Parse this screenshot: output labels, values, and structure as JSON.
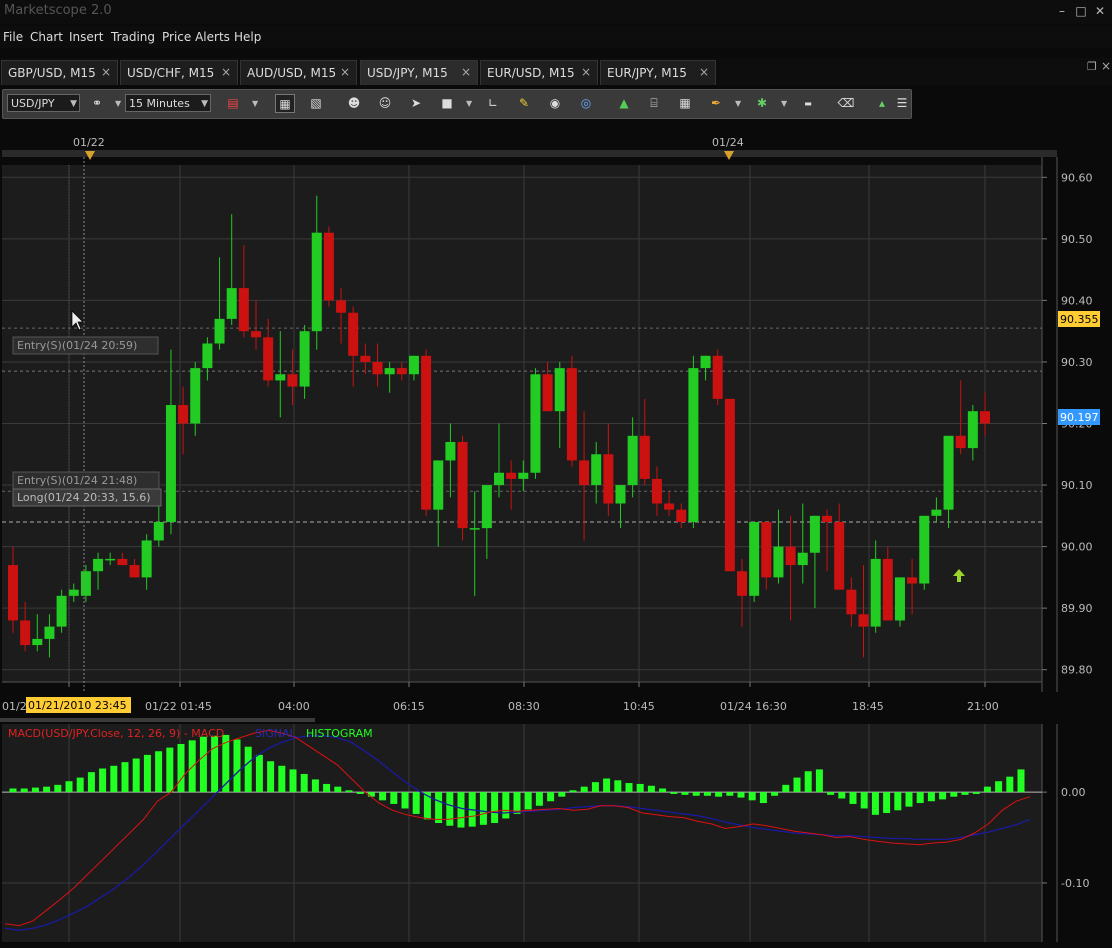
{
  "window": {
    "title": "Marketscope 2.0",
    "controls": {
      "minimize": "–",
      "maximize": "□",
      "close": "✕"
    }
  },
  "menu": [
    "File",
    "Chart",
    "Insert",
    "Trading",
    "Price Alerts",
    "Help"
  ],
  "tabs": [
    {
      "label": "GBP/USD, M15",
      "active": false
    },
    {
      "label": "USD/CHF, M15",
      "active": false
    },
    {
      "label": "AUD/USD, M15",
      "active": false
    },
    {
      "label": "USD/JPY, M15",
      "active": true
    },
    {
      "label": "EUR/USD, M15",
      "active": false
    },
    {
      "label": "EUR/JPY, M15",
      "active": false
    }
  ],
  "tab_close": "×",
  "toolbar": {
    "symbol": "USD/JPY",
    "timeframe": "15 Minutes",
    "icons": [
      "link-icon",
      "bar-style-icon",
      "candle-view-icon",
      "list-view-icon",
      "trader-icon",
      "trader-down-icon",
      "pointer-icon",
      "stop-icon",
      "cursor-icon",
      "note-icon",
      "eye-icon",
      "globe-icon",
      "chart-icon",
      "text-icon",
      "grid-icon",
      "pencil-icon",
      "signal-icon",
      "label-icon",
      "eraser-icon",
      "tree-icon",
      "menu-icon"
    ]
  },
  "colors": {
    "bull": "#22cc22",
    "bear": "#cc1111",
    "grid": "#3a3a3a",
    "axis_text": "#bbbbbb",
    "price_marker_orange": "#ffcc33",
    "price_marker_blue": "#3399ff",
    "macd_line": "#dd1111",
    "signal_line": "#1a1aa0",
    "histogram": "#22ff22"
  },
  "chart_data": [
    {
      "type": "candlestick",
      "symbol": "USD/JPY",
      "timeframe": "M15",
      "top_markers": [
        "01/22",
        "01/24"
      ],
      "x_tick_labels": [
        "01/2",
        "01/22 01:45",
        "04:00",
        "06:15",
        "08:30",
        "10:45",
        "01/24 16:30",
        "18:45",
        "21:00"
      ],
      "crosshair_time": "01/21/2010 23:45",
      "y_ticks": [
        "90.60",
        "90.50",
        "90.40",
        "90.30",
        "90.20",
        "90.10",
        "90.00",
        "89.90",
        "89.80"
      ],
      "ylim": [
        89.78,
        90.62
      ],
      "price_markers": [
        {
          "label": "90.355",
          "value": 90.355,
          "color": "orange"
        },
        {
          "label": "90.197",
          "value": 90.197,
          "color": "blue"
        }
      ],
      "order_labels": [
        {
          "text": "Entry(S)(01/24 20:59)",
          "price": 90.285
        },
        {
          "text": "Entry(S)(01/24 21:48)",
          "price": 90.09
        },
        {
          "text": "Long(01/24 20:33, 15.6)",
          "price": 90.065
        }
      ],
      "stop_level": 90.04,
      "candles": [
        [
          89.97,
          90.0,
          89.86,
          89.88
        ],
        [
          89.88,
          89.91,
          89.83,
          89.84
        ],
        [
          89.84,
          89.89,
          89.83,
          89.85
        ],
        [
          89.85,
          89.89,
          89.82,
          89.87
        ],
        [
          89.87,
          89.93,
          89.86,
          89.92
        ],
        [
          89.92,
          89.94,
          89.91,
          89.93
        ],
        [
          89.92,
          89.97,
          89.91,
          89.96
        ],
        [
          89.96,
          89.99,
          89.93,
          89.98
        ],
        [
          89.98,
          89.99,
          89.97,
          89.98
        ],
        [
          89.98,
          89.99,
          89.97,
          89.97
        ],
        [
          89.97,
          89.98,
          89.95,
          89.95
        ],
        [
          89.95,
          90.02,
          89.93,
          90.01
        ],
        [
          90.01,
          90.1,
          90.0,
          90.04
        ],
        [
          90.04,
          90.32,
          90.02,
          90.23
        ],
        [
          90.23,
          90.26,
          90.15,
          90.2
        ],
        [
          90.2,
          90.3,
          90.18,
          90.29
        ],
        [
          90.29,
          90.34,
          90.27,
          90.33
        ],
        [
          90.33,
          90.47,
          90.32,
          90.37
        ],
        [
          90.37,
          90.54,
          90.36,
          90.42
        ],
        [
          90.42,
          90.49,
          90.34,
          90.35
        ],
        [
          90.35,
          90.4,
          90.32,
          90.34
        ],
        [
          90.34,
          90.37,
          90.26,
          90.27
        ],
        [
          90.27,
          90.35,
          90.21,
          90.28
        ],
        [
          90.28,
          90.32,
          90.23,
          90.26
        ],
        [
          90.26,
          90.36,
          90.24,
          90.35
        ],
        [
          90.35,
          90.57,
          90.32,
          90.51
        ],
        [
          90.51,
          90.52,
          90.39,
          90.4
        ],
        [
          90.4,
          90.42,
          90.33,
          90.38
        ],
        [
          90.38,
          90.39,
          90.26,
          90.31
        ],
        [
          90.31,
          90.33,
          90.28,
          90.3
        ],
        [
          90.3,
          90.33,
          90.26,
          90.28
        ],
        [
          90.28,
          90.3,
          90.25,
          90.29
        ],
        [
          90.29,
          90.3,
          90.27,
          90.28
        ],
        [
          90.28,
          90.31,
          90.27,
          90.31
        ],
        [
          90.31,
          90.32,
          90.05,
          90.06
        ],
        [
          90.06,
          90.14,
          90.0,
          90.14
        ],
        [
          90.14,
          90.2,
          90.08,
          90.17
        ],
        [
          90.17,
          90.18,
          90.01,
          90.03
        ],
        [
          90.03,
          90.09,
          89.92,
          90.03
        ],
        [
          90.03,
          90.07,
          89.98,
          90.1
        ],
        [
          90.1,
          90.2,
          90.08,
          90.12
        ],
        [
          90.12,
          90.14,
          90.06,
          90.11
        ],
        [
          90.11,
          90.14,
          90.09,
          90.12
        ],
        [
          90.12,
          90.29,
          90.11,
          90.28
        ],
        [
          90.28,
          90.3,
          90.22,
          90.22
        ],
        [
          90.22,
          90.3,
          90.16,
          90.29
        ],
        [
          90.29,
          90.31,
          90.13,
          90.14
        ],
        [
          90.14,
          90.22,
          90.01,
          90.1
        ],
        [
          90.1,
          90.17,
          90.07,
          90.15
        ],
        [
          90.15,
          90.2,
          90.05,
          90.07
        ],
        [
          90.07,
          90.09,
          90.03,
          90.1
        ],
        [
          90.1,
          90.21,
          90.08,
          90.18
        ],
        [
          90.18,
          90.24,
          90.1,
          90.11
        ],
        [
          90.11,
          90.13,
          90.05,
          90.07
        ],
        [
          90.07,
          90.09,
          90.05,
          90.06
        ],
        [
          90.06,
          90.07,
          90.03,
          90.04
        ],
        [
          90.04,
          90.31,
          90.03,
          90.29
        ],
        [
          90.29,
          90.31,
          90.27,
          90.31
        ],
        [
          90.31,
          90.32,
          90.23,
          90.24
        ],
        [
          90.24,
          90.24,
          89.96,
          89.96
        ],
        [
          89.96,
          89.98,
          89.87,
          89.92
        ],
        [
          89.92,
          90.04,
          89.91,
          90.04
        ],
        [
          90.04,
          90.04,
          89.93,
          89.95
        ],
        [
          89.95,
          90.06,
          89.94,
          90.0
        ],
        [
          90.0,
          90.05,
          89.88,
          89.97
        ],
        [
          89.97,
          90.07,
          89.94,
          89.99
        ],
        [
          89.99,
          90.05,
          89.9,
          90.05
        ],
        [
          90.05,
          90.06,
          89.96,
          90.04
        ],
        [
          90.04,
          90.07,
          89.94,
          89.93
        ],
        [
          89.93,
          89.95,
          89.87,
          89.89
        ],
        [
          89.89,
          89.97,
          89.82,
          89.87
        ],
        [
          89.87,
          90.01,
          89.86,
          89.98
        ],
        [
          89.98,
          90.0,
          89.88,
          89.88
        ],
        [
          89.88,
          89.95,
          89.87,
          89.95
        ],
        [
          89.95,
          89.98,
          89.89,
          89.94
        ],
        [
          89.94,
          90.05,
          89.93,
          90.05
        ],
        [
          90.05,
          90.08,
          90.04,
          90.06
        ],
        [
          90.06,
          90.18,
          90.03,
          90.18
        ],
        [
          90.18,
          90.27,
          90.15,
          90.16
        ],
        [
          90.16,
          90.23,
          90.14,
          90.22
        ],
        [
          90.22,
          90.25,
          90.18,
          90.2
        ]
      ]
    },
    {
      "type": "bar-line",
      "title": "MACD(USD/JPY.Close, 12, 26, 9) - MACD",
      "legend": [
        "SIGNAL",
        "HISTOGRAM"
      ],
      "y_ticks": [
        "0.00",
        "-0.10"
      ],
      "ylim": [
        -0.165,
        0.075
      ],
      "macd": [
        -0.145,
        -0.147,
        -0.142,
        -0.13,
        -0.118,
        -0.105,
        -0.09,
        -0.075,
        -0.06,
        -0.045,
        -0.03,
        -0.01,
        0.0,
        0.02,
        0.035,
        0.048,
        0.055,
        0.06,
        0.065,
        0.068,
        0.065,
        0.06,
        0.05,
        0.04,
        0.03,
        0.015,
        0.0,
        -0.012,
        -0.02,
        -0.025,
        -0.028,
        -0.03,
        -0.03,
        -0.028,
        -0.026,
        -0.022,
        -0.02,
        -0.021,
        -0.02,
        -0.019,
        -0.018,
        -0.02,
        -0.019,
        -0.015,
        -0.015,
        -0.017,
        -0.023,
        -0.025,
        -0.027,
        -0.028,
        -0.032,
        -0.035,
        -0.04,
        -0.038,
        -0.035,
        -0.037,
        -0.04,
        -0.043,
        -0.045,
        -0.047,
        -0.05,
        -0.049,
        -0.052,
        -0.054,
        -0.056,
        -0.057,
        -0.058,
        -0.056,
        -0.055,
        -0.052,
        -0.045,
        -0.035,
        -0.02,
        -0.01,
        -0.005
      ],
      "signal": [
        -0.15,
        -0.152,
        -0.15,
        -0.146,
        -0.14,
        -0.133,
        -0.125,
        -0.115,
        -0.105,
        -0.093,
        -0.08,
        -0.065,
        -0.05,
        -0.035,
        -0.02,
        -0.005,
        0.01,
        0.025,
        0.038,
        0.048,
        0.055,
        0.06,
        0.062,
        0.062,
        0.06,
        0.055,
        0.045,
        0.034,
        0.022,
        0.01,
        0.0,
        -0.008,
        -0.014,
        -0.018,
        -0.02,
        -0.022,
        -0.023,
        -0.022,
        -0.021,
        -0.02,
        -0.019,
        -0.017,
        -0.016,
        -0.015,
        -0.015,
        -0.016,
        -0.018,
        -0.02,
        -0.022,
        -0.024,
        -0.026,
        -0.029,
        -0.033,
        -0.036,
        -0.039,
        -0.041,
        -0.043,
        -0.045,
        -0.046,
        -0.047,
        -0.048,
        -0.048,
        -0.049,
        -0.05,
        -0.051,
        -0.051,
        -0.052,
        -0.052,
        -0.052,
        -0.05,
        -0.047,
        -0.044,
        -0.04,
        -0.036,
        -0.03
      ],
      "histogram": [
        0.004,
        0.004,
        0.005,
        0.006,
        0.008,
        0.012,
        0.016,
        0.022,
        0.026,
        0.029,
        0.033,
        0.037,
        0.041,
        0.045,
        0.049,
        0.053,
        0.057,
        0.061,
        0.062,
        0.063,
        0.058,
        0.05,
        0.041,
        0.034,
        0.029,
        0.025,
        0.02,
        0.014,
        0.009,
        0.006,
        0.002,
        -0.002,
        -0.005,
        -0.009,
        -0.013,
        -0.018,
        -0.024,
        -0.03,
        -0.034,
        -0.037,
        -0.039,
        -0.038,
        -0.036,
        -0.034,
        -0.029,
        -0.024,
        -0.019,
        -0.015,
        -0.01,
        -0.005,
        0.002,
        0.006,
        0.011,
        0.015,
        0.013,
        0.01,
        0.009,
        0.007,
        0.004,
        -0.002,
        -0.003,
        -0.004,
        -0.004,
        -0.005,
        -0.004,
        -0.006,
        -0.009,
        -0.012,
        -0.004,
        0.008,
        0.016,
        0.023,
        0.025,
        -0.003,
        -0.007,
        -0.013,
        -0.018,
        -0.025,
        -0.023,
        -0.02,
        -0.016,
        -0.012,
        -0.01,
        -0.008,
        -0.005,
        -0.003,
        -0.002,
        0.006,
        0.012,
        0.017,
        0.025,
        0.038,
        0.042,
        0.043
      ]
    }
  ]
}
